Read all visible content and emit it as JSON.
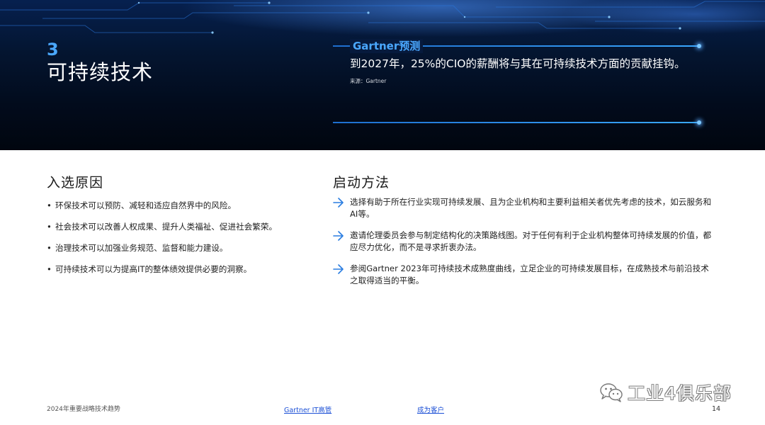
{
  "hero": {
    "number": "3",
    "title": "可持续技术",
    "prediction_label": "Gartner预测",
    "prediction_text": "到2027年，25%的CIO的薪酬将与其在可持续技术方面的贡献挂钩。",
    "source": "来源：Gartner"
  },
  "left": {
    "heading": "入选原因",
    "bullets": [
      "环保技术可以预防、减轻和适应自然界中的风险。",
      "社会技术可以改善人权成果、提升人类福祉、促进社会繁荣。",
      "治理技术可以加强业务规范、监督和能力建设。",
      "可持续技术可以为提高IT的整体绩效提供必要的洞察。"
    ]
  },
  "right": {
    "heading": "启动方法",
    "steps": [
      "选择有助于所在行业实现可持续发展、且为企业机构和主要利益相关者优先考虑的技术，如云服务和AI等。",
      "邀请伦理委员会参与制定结构化的决策路线图。对于任何有利于企业机构整体可持续发展的价值，都应尽力优化，而不是寻求折衷办法。",
      "参阅Gartner 2023年可持续技术成熟度曲线，立足企业的可持续发展目标，在成熟技术与前沿技术之取得适当的平衡。"
    ]
  },
  "footer": {
    "report_title": "2024年重要战略技术趋势",
    "link_it": "Gartner IT高管",
    "link_client": "成为客户",
    "page_number": "14"
  },
  "watermark": {
    "icon": "wechat-icon",
    "text": "工业4俱乐部"
  },
  "colors": {
    "accent_blue": "#4aa8ff",
    "link_blue": "#1b4fd6",
    "arrow_blue": "#2a7de1",
    "hero_dark": "#020b1c"
  }
}
